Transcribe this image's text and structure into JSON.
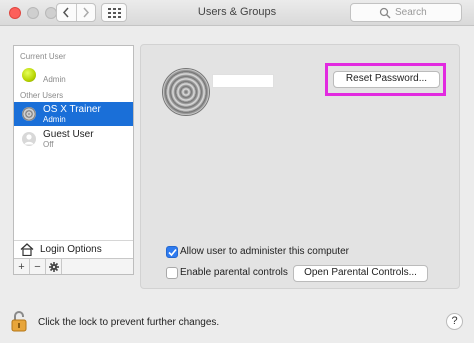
{
  "window": {
    "title": "Users & Groups"
  },
  "search": {
    "placeholder": "Search"
  },
  "sidebar": {
    "current_user_header": "Current User",
    "current_user": {
      "name": "",
      "role": "Admin",
      "avatar_color": "#b7d400"
    },
    "other_users_header": "Other Users",
    "users": [
      {
        "name": "OS X Trainer",
        "role": "Admin",
        "selected": true
      },
      {
        "name": "Guest User",
        "role": "Off",
        "selected": false
      }
    ],
    "login_options_label": "Login Options",
    "add_label": "+",
    "remove_label": "−",
    "action_label": "✱"
  },
  "main": {
    "username_value": "",
    "reset_password_label": "Reset Password...",
    "allow_admin_label": "Allow user to administer this computer",
    "allow_admin_checked": true,
    "parental_controls_label": "Enable parental controls",
    "parental_controls_checked": false,
    "open_parental_label": "Open Parental Controls..."
  },
  "footer": {
    "lock_message": "Click the lock to prevent further changes.",
    "help_label": "?"
  },
  "colors": {
    "selection": "#1a6fd8",
    "highlight_box": "#e22ae0",
    "checkbox_accent": "#2e7bf0"
  }
}
